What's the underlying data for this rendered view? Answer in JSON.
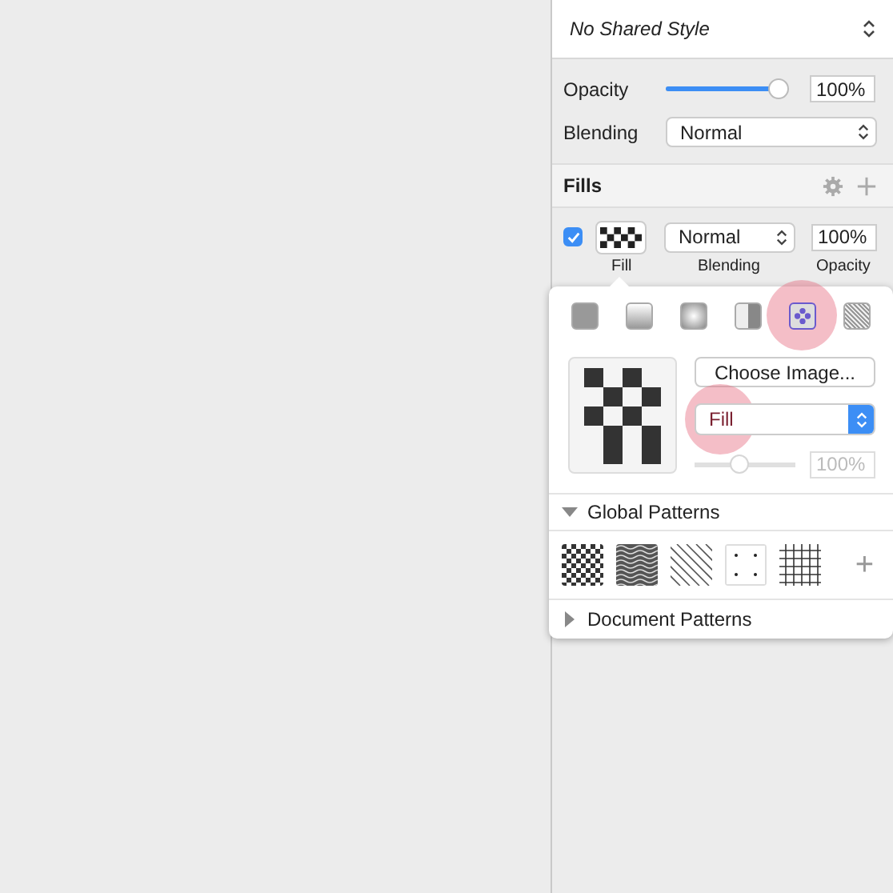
{
  "style_selector": {
    "value": "No Shared Style"
  },
  "opacity": {
    "label": "Opacity",
    "level": 1.0,
    "reading": "100%"
  },
  "blending": {
    "label": "Blending",
    "value": "Normal"
  },
  "fills": {
    "title": "Fills",
    "fill": {
      "checked": true,
      "blending": "Normal",
      "opacity": "100%",
      "labels": [
        "Fill",
        "Blending",
        "Opacity"
      ]
    }
  },
  "popover": {
    "fill_types": [
      {
        "kind": "solid",
        "selected": false,
        "highlighted": false
      },
      {
        "kind": "linear",
        "selected": false,
        "highlighted": false
      },
      {
        "kind": "radial",
        "selected": false,
        "highlighted": false
      },
      {
        "kind": "angular",
        "selected": false,
        "highlighted": false
      },
      {
        "kind": "pattern",
        "selected": true,
        "highlighted": true
      },
      {
        "kind": "noise",
        "selected": false,
        "highlighted": false
      }
    ],
    "choose_image": "Choose Image...",
    "mode_dropdown": {
      "value": "Fill",
      "highlighted": true
    },
    "slider": {
      "level": 0.45,
      "reading": "100%",
      "disabled": true
    },
    "global_patterns": {
      "title": "Global Patterns",
      "expanded": true,
      "items": [
        {
          "kind": "checker"
        },
        {
          "kind": "waves"
        },
        {
          "kind": "diagonal"
        },
        {
          "kind": "dots"
        },
        {
          "kind": "grid"
        }
      ],
      "add": "+"
    },
    "document_patterns": {
      "title": "Document Patterns",
      "expanded": false
    }
  }
}
